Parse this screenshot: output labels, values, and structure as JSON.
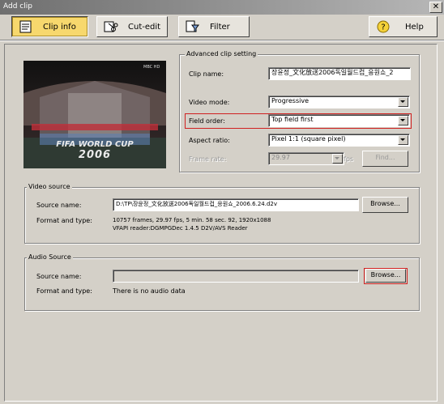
{
  "window": {
    "title": "Add clip",
    "close_glyph": "✕"
  },
  "toolbar": {
    "clip_info": "Clip info",
    "cut_edit": "Cut-edit",
    "filter": "Filter",
    "help": "Help"
  },
  "advanced": {
    "legend": "Advanced clip setting",
    "clip_name_label": "Clip name:",
    "clip_name_value": "장윤정_文化放送2006독일월드컵_응원쇼_2",
    "video_mode_label": "Video mode:",
    "video_mode_value": "Progressive",
    "field_order_label": "Field order:",
    "field_order_value": "Top field first",
    "aspect_ratio_label": "Aspect ratio:",
    "aspect_ratio_value": "Pixel 1:1 (square pixel)",
    "frame_rate_label": "Frame rate:",
    "frame_rate_value": "29.97",
    "fps_label": "fps",
    "find_button": "Find..."
  },
  "preview": {
    "banner_line1": "FIFA WORLD CUP",
    "banner_line2": "2006",
    "logo": "MBC HD"
  },
  "video_source": {
    "legend": "Video source",
    "source_name_label": "Source name:",
    "source_name_value": "D:\\TP\\장윤정_文化放送2006독일월드컵_응원쇼_2006.6.24.d2v",
    "browse_button": "Browse...",
    "format_label": "Format and type:",
    "format_line1": "10757 frames,  29.97 fps,  5 min. 58 sec. 92,  1920x1088",
    "format_line2": "VFAPI reader:DGMPGDec 1.4.5 D2V/AVS Reader"
  },
  "audio_source": {
    "legend": "Audio Source",
    "source_name_label": "Source name:",
    "source_name_value": "",
    "browse_button": "Browse...",
    "format_label": "Format and type:",
    "format_value": "There is no audio data"
  },
  "colors": {
    "active_tab": "#f7d86d",
    "highlight": "#d02020",
    "face": "#d4d0c8"
  }
}
